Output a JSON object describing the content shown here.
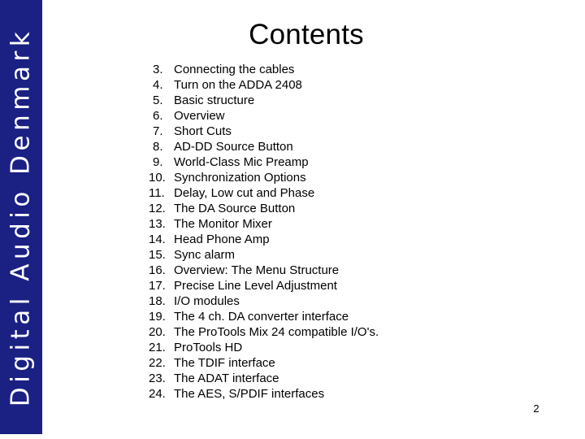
{
  "slide": {
    "title": "Contents",
    "page_number": "2",
    "background_color": "#ffffff",
    "accent_color": "#1b2083"
  },
  "brand_bar": {
    "text": "Digital Audio Denmark",
    "color": "#1b2083",
    "text_color": "#ffffff"
  },
  "contents": {
    "items": [
      {
        "number": "3.",
        "label": "Connecting the cables"
      },
      {
        "number": "4.",
        "label": "Turn on the ADDA 2408"
      },
      {
        "number": "5.",
        "label": "Basic structure"
      },
      {
        "number": "6.",
        "label": "Overview"
      },
      {
        "number": "7.",
        "label": "Short Cuts"
      },
      {
        "number": "8.",
        "label": "AD-DD Source Button"
      },
      {
        "number": "9.",
        "label": "World-Class Mic Preamp"
      },
      {
        "number": "10.",
        "label": "Synchronization Options"
      },
      {
        "number": "11.",
        "label": "Delay, Low cut and Phase"
      },
      {
        "number": "12.",
        "label": "The DA Source Button"
      },
      {
        "number": "13.",
        "label": "The Monitor Mixer"
      },
      {
        "number": "14.",
        "label": "Head Phone Amp"
      },
      {
        "number": "15.",
        "label": "Sync alarm"
      },
      {
        "number": "16.",
        "label": "Overview: The Menu Structure"
      },
      {
        "number": "17.",
        "label": "Precise Line Level Adjustment"
      },
      {
        "number": "18.",
        "label": "I/O modules"
      },
      {
        "number": "19.",
        "label": "The 4 ch. DA converter interface"
      },
      {
        "number": "20.",
        "label": "The ProTools Mix 24 compatible I/O's."
      },
      {
        "number": "21.",
        "label": "ProTools HD"
      },
      {
        "number": "22.",
        "label": "The TDIF interface"
      },
      {
        "number": "23.",
        "label": "The ADAT interface"
      },
      {
        "number": "24.",
        "label": "The AES, S/PDIF interfaces"
      }
    ]
  }
}
